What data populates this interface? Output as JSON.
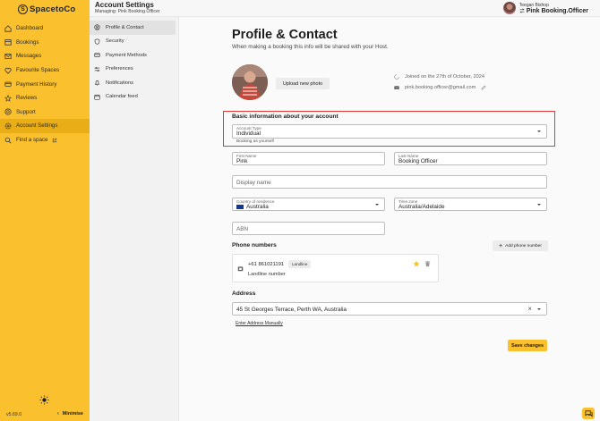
{
  "app": {
    "logo_text": "SpacetoCo",
    "logo_mark": "S"
  },
  "sidebar": {
    "items": [
      {
        "label": "Dashboard",
        "icon": "home-icon",
        "active": false
      },
      {
        "label": "Bookings",
        "icon": "bookings-icon",
        "active": false
      },
      {
        "label": "Messages",
        "icon": "mail-icon",
        "active": false
      },
      {
        "label": "Favourite Spaces",
        "icon": "heart-icon",
        "active": false
      },
      {
        "label": "Payment History",
        "icon": "payment-history-icon",
        "active": false
      },
      {
        "label": "Reviews",
        "icon": "star-icon",
        "active": false
      },
      {
        "label": "Support",
        "icon": "help-icon",
        "active": false
      },
      {
        "label": "Account Settings",
        "icon": "gear-icon",
        "active": true
      },
      {
        "label": "Find a space",
        "icon": "search-icon",
        "active": false
      }
    ],
    "version": "v5.69.0",
    "minimise_label": "Minimise"
  },
  "header": {
    "title": "Account Settings",
    "subtitle": "Managing: Pink Booking.Officer",
    "user_name": "Teegan Bishop",
    "user_role": "Pink Booking.Officer"
  },
  "subnav": {
    "items": [
      {
        "label": "Profile & Contact",
        "icon": "profile-icon",
        "active": true
      },
      {
        "label": "Security",
        "icon": "shield-icon",
        "active": false
      },
      {
        "label": "Payment Methods",
        "icon": "card-icon",
        "active": false
      },
      {
        "label": "Preferences",
        "icon": "sliders-icon",
        "active": false
      },
      {
        "label": "Notifications",
        "icon": "bell-icon",
        "active": false
      },
      {
        "label": "Calendar feed",
        "icon": "calendar-icon",
        "active": false
      }
    ]
  },
  "profile": {
    "title": "Profile & Contact",
    "lead": "When making a booking this info will be shared with your Host.",
    "upload_label": "Upload new photo",
    "joined": "Joined on the 27th of October, 2024",
    "email": "pink.booking.officer@gmail.com"
  },
  "basic": {
    "title": "Basic information about your account",
    "account_type_label": "Account Type",
    "account_type_value": "Individual",
    "account_type_helper": "Booking as yourself",
    "first_name_label": "First Name",
    "first_name_value": "Pink",
    "last_name_label": "Last Name",
    "last_name_value": "Booking Officer",
    "display_name_placeholder": "Display name",
    "country_label": "Country of residence",
    "country_value": "Australia",
    "timezone_label": "Time zone",
    "timezone_value": "Australia/Adelaide",
    "abn_placeholder": "ABN"
  },
  "phones": {
    "title": "Phone numbers",
    "add_label": "Add phone number",
    "items": [
      {
        "number": "+61 861021191",
        "tag": "Landline",
        "description": "Landline number"
      }
    ]
  },
  "address": {
    "title": "Address",
    "value": "45 St Georges Terrace, Perth WA, Australia",
    "manual_link": "Enter Address Manually"
  },
  "actions": {
    "save_label": "Save changes"
  },
  "colors": {
    "brand_yellow": "#fbc02d",
    "highlight_red": "#e53935",
    "active_nav": "#e8ad17"
  }
}
